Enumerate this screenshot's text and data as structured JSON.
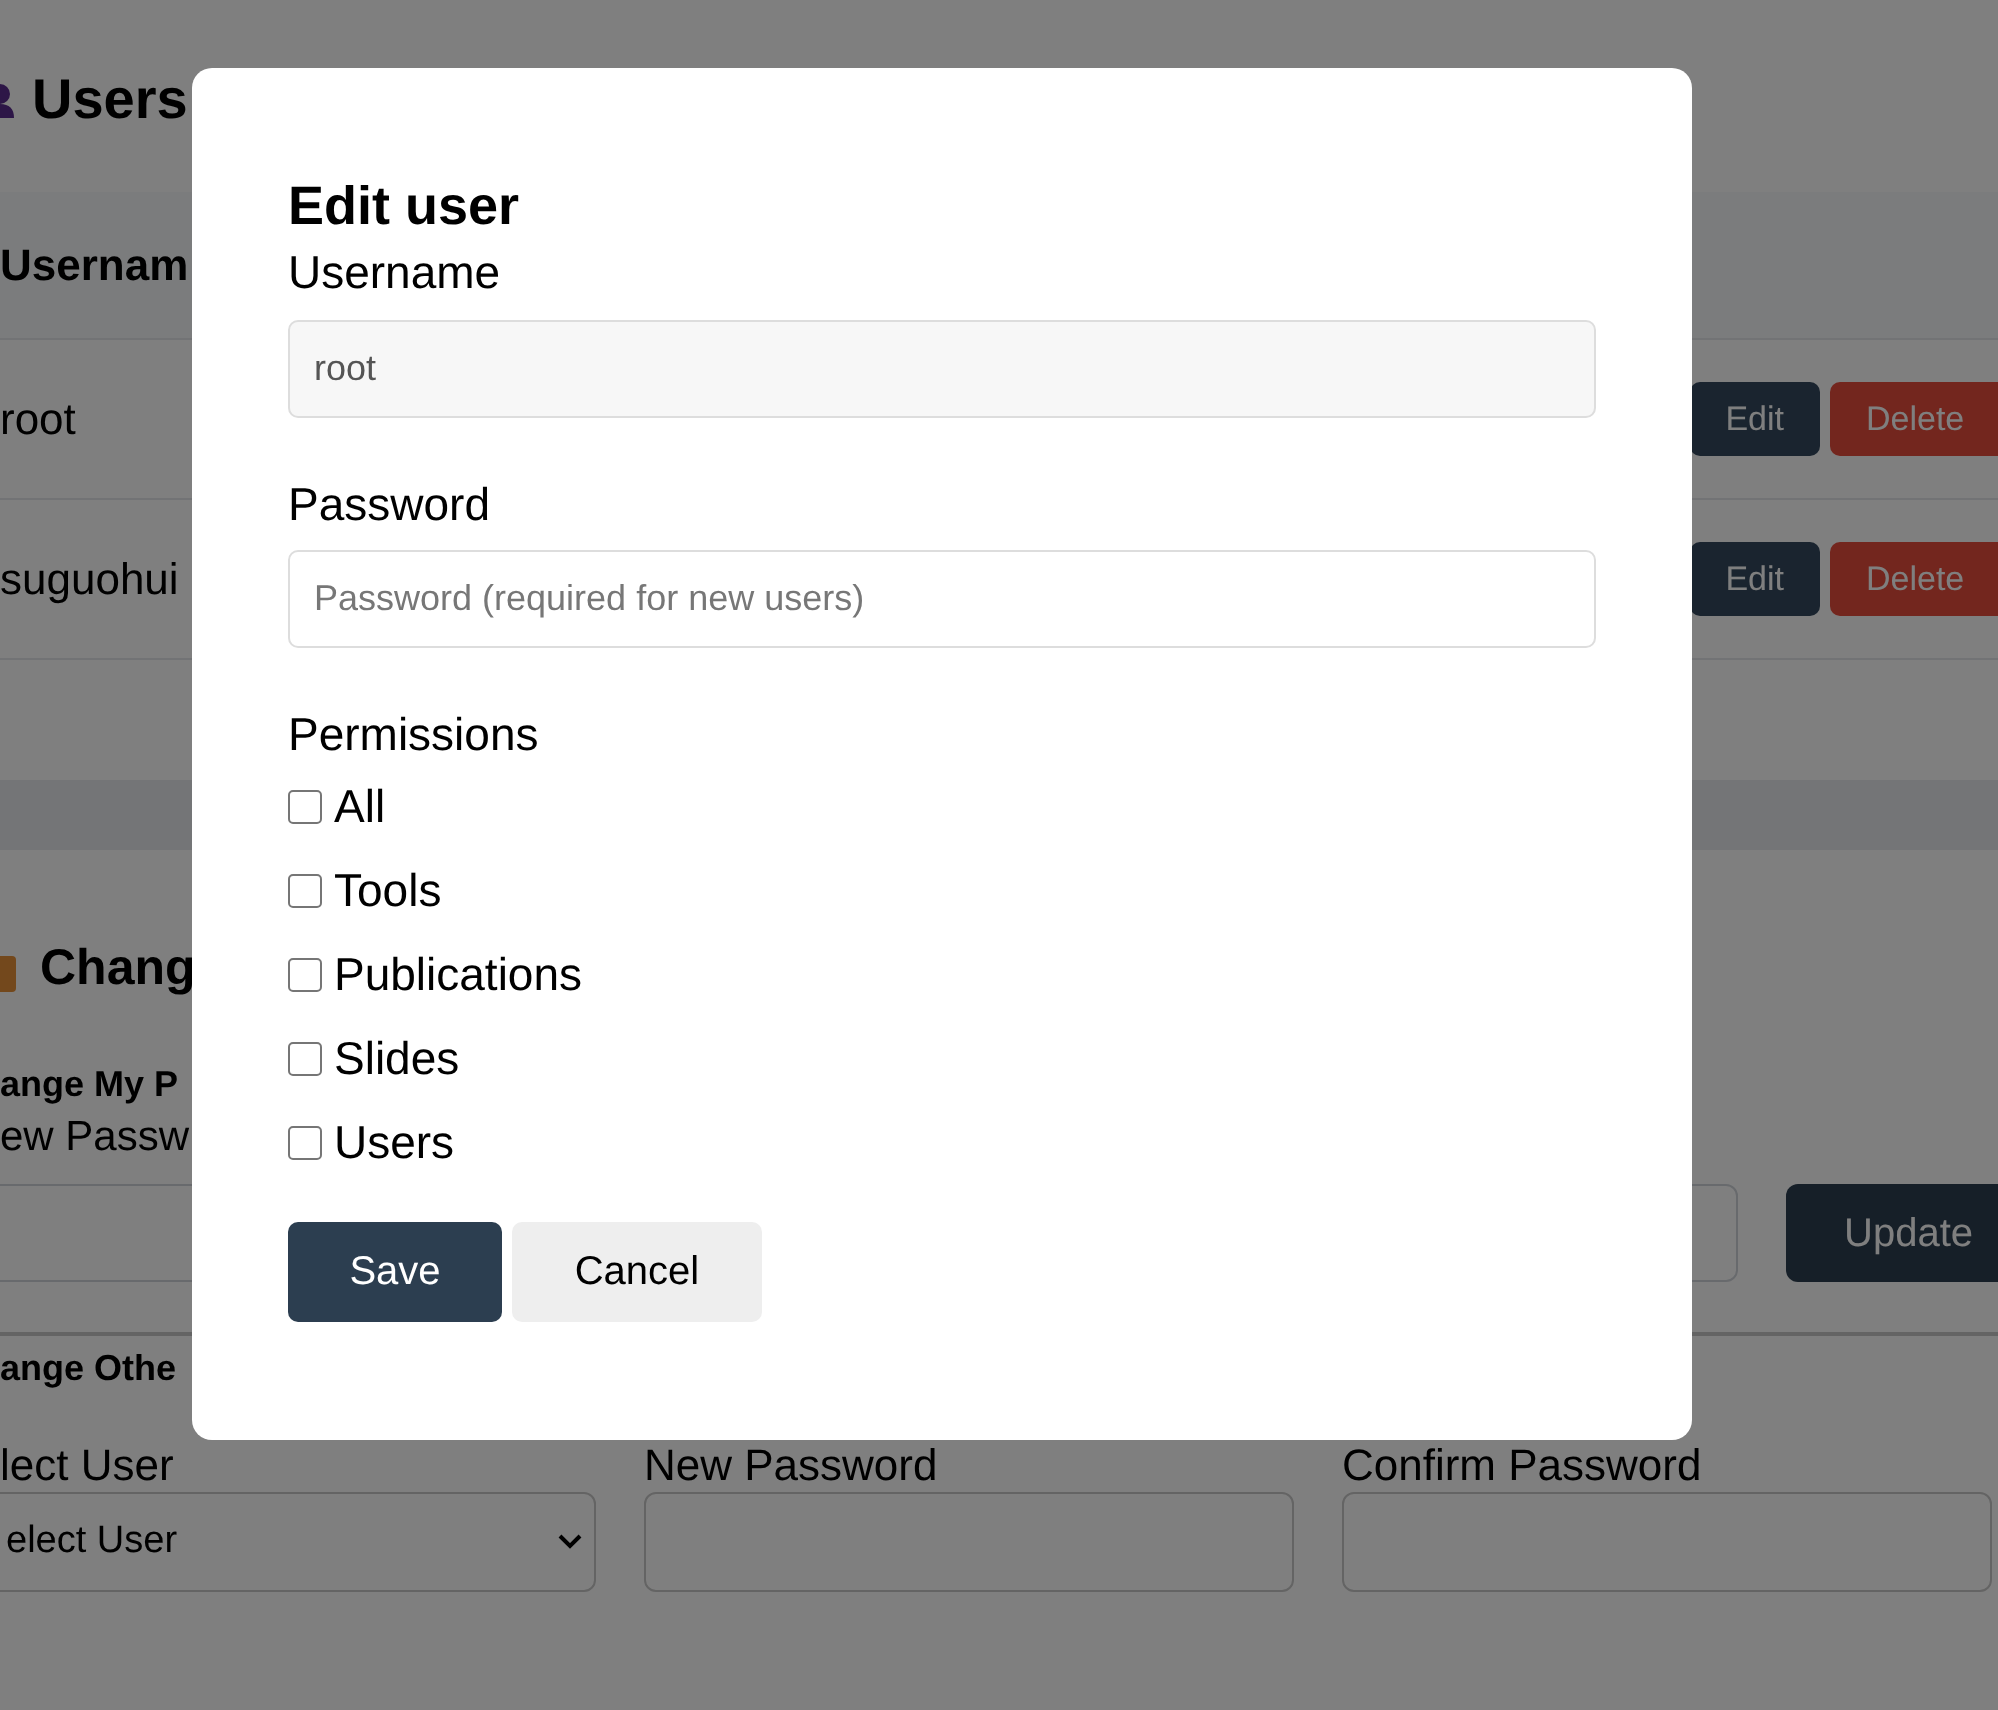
{
  "page": {
    "users_heading": "Users",
    "users_table": {
      "header": "Usernam",
      "rows": [
        {
          "username": "root",
          "edit": "Edit",
          "delete": "Delete"
        },
        {
          "username": "suguohui",
          "edit": "Edit",
          "delete": "Delete"
        }
      ]
    },
    "change_heading": "Chang",
    "my_password": {
      "title": "ange My P",
      "label": "ew Passw",
      "button": "Update"
    },
    "other_password": {
      "title": "ange Othe",
      "user_label": "lect User",
      "user_select": "elect User",
      "new_label": "New Password",
      "confirm_label": "Confirm Password"
    }
  },
  "dialog": {
    "title": "Edit user",
    "username_label": "Username",
    "username_value": "root",
    "password_label": "Password",
    "password_placeholder": "Password (required for new users)",
    "permissions_label": "Permissions",
    "permissions": [
      {
        "label": "All",
        "checked": false
      },
      {
        "label": "Tools",
        "checked": false
      },
      {
        "label": "Publications",
        "checked": false
      },
      {
        "label": "Slides",
        "checked": false
      },
      {
        "label": "Users",
        "checked": false
      }
    ],
    "buttons": [
      {
        "label": "Save",
        "kind": "primary"
      },
      {
        "label": "Cancel",
        "kind": "secondary"
      }
    ]
  }
}
